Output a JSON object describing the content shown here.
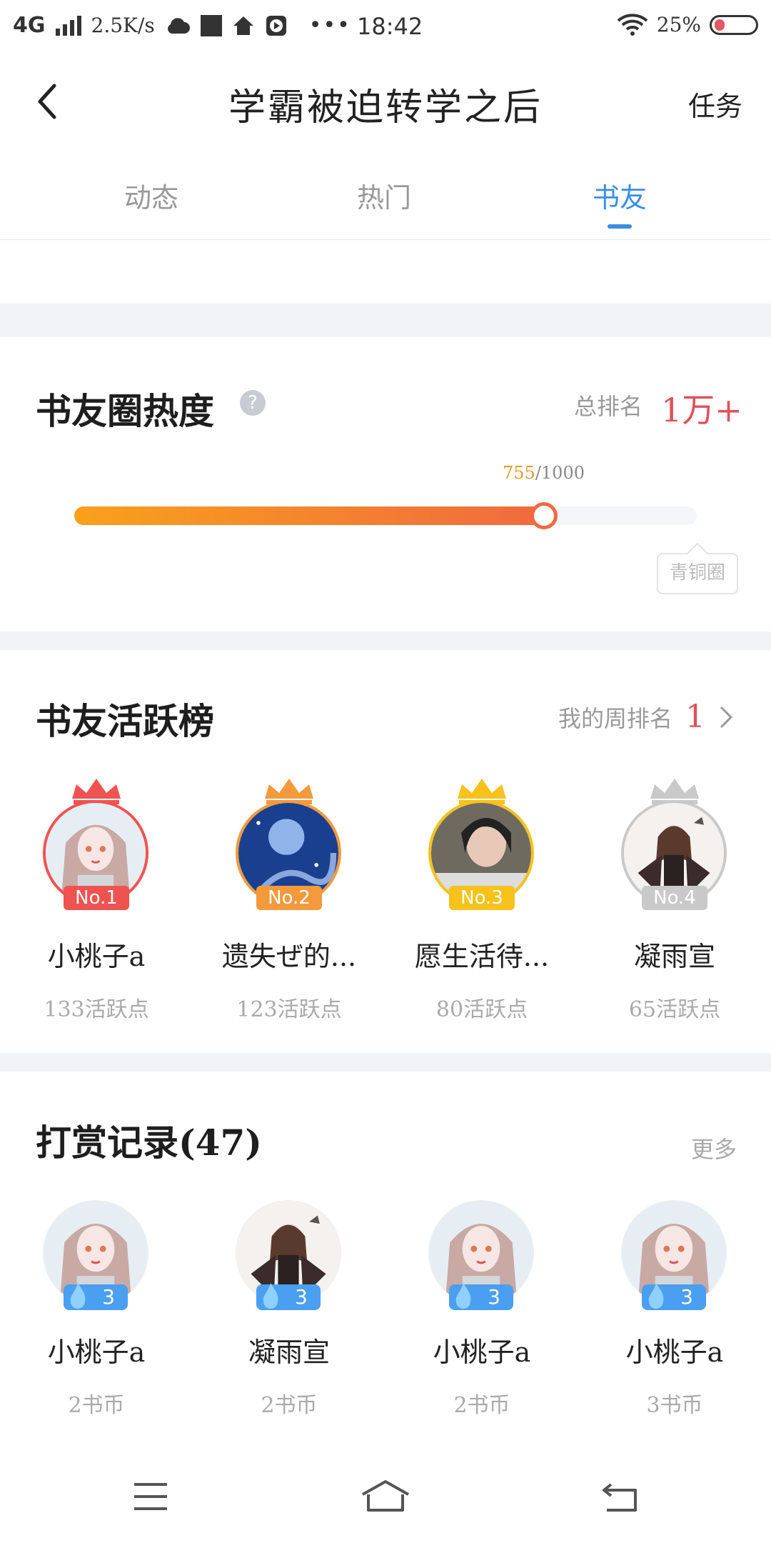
{
  "status_bar": {
    "network": "4G",
    "speed": "2.5K/s",
    "time": "18:42",
    "battery": "25%"
  },
  "header": {
    "title": "学霸被迫转学之后",
    "task_label": "任务"
  },
  "tabs": [
    {
      "label": "动态",
      "active": false
    },
    {
      "label": "热门",
      "active": false
    },
    {
      "label": "书友",
      "active": true
    }
  ],
  "heat": {
    "title": "书友圈热度",
    "help": "?",
    "total_rank_label": "总排名",
    "total_rank_value": "1万+",
    "progress_current": "755",
    "progress_total": "/1000",
    "progress_fraction": 0.755,
    "level_tip": "青铜圈"
  },
  "active_board": {
    "title": "书友活跃榜",
    "my_rank_label": "我的周排名",
    "my_rank_value": "1",
    "members": [
      {
        "badge": "No.1",
        "name": "小桃子a",
        "points": "133活跃点",
        "color": "#ef5350"
      },
      {
        "badge": "No.2",
        "name": "遗失ぜ的...",
        "points": "123活跃点",
        "color": "#f39a3c"
      },
      {
        "badge": "No.3",
        "name": "愿生活待...",
        "points": "80活跃点",
        "color": "#f6c21b"
      },
      {
        "badge": "No.4",
        "name": "凝雨宣",
        "points": "65活跃点",
        "color": "#c9c9c9"
      }
    ]
  },
  "rewards": {
    "title": "打赏记录(47)",
    "more_label": "更多",
    "items": [
      {
        "level": "3",
        "name": "小桃子a",
        "amount": "2书币"
      },
      {
        "level": "3",
        "name": "凝雨宣",
        "amount": "2书币"
      },
      {
        "level": "3",
        "name": "小桃子a",
        "amount": "2书币"
      },
      {
        "level": "3",
        "name": "小桃子a",
        "amount": "3书币"
      }
    ]
  },
  "colors": {
    "accent": "#3a8ee6",
    "rank_red": "#e2505a",
    "progress_start": "#f8a11b",
    "progress_end": "#f06a3f"
  }
}
